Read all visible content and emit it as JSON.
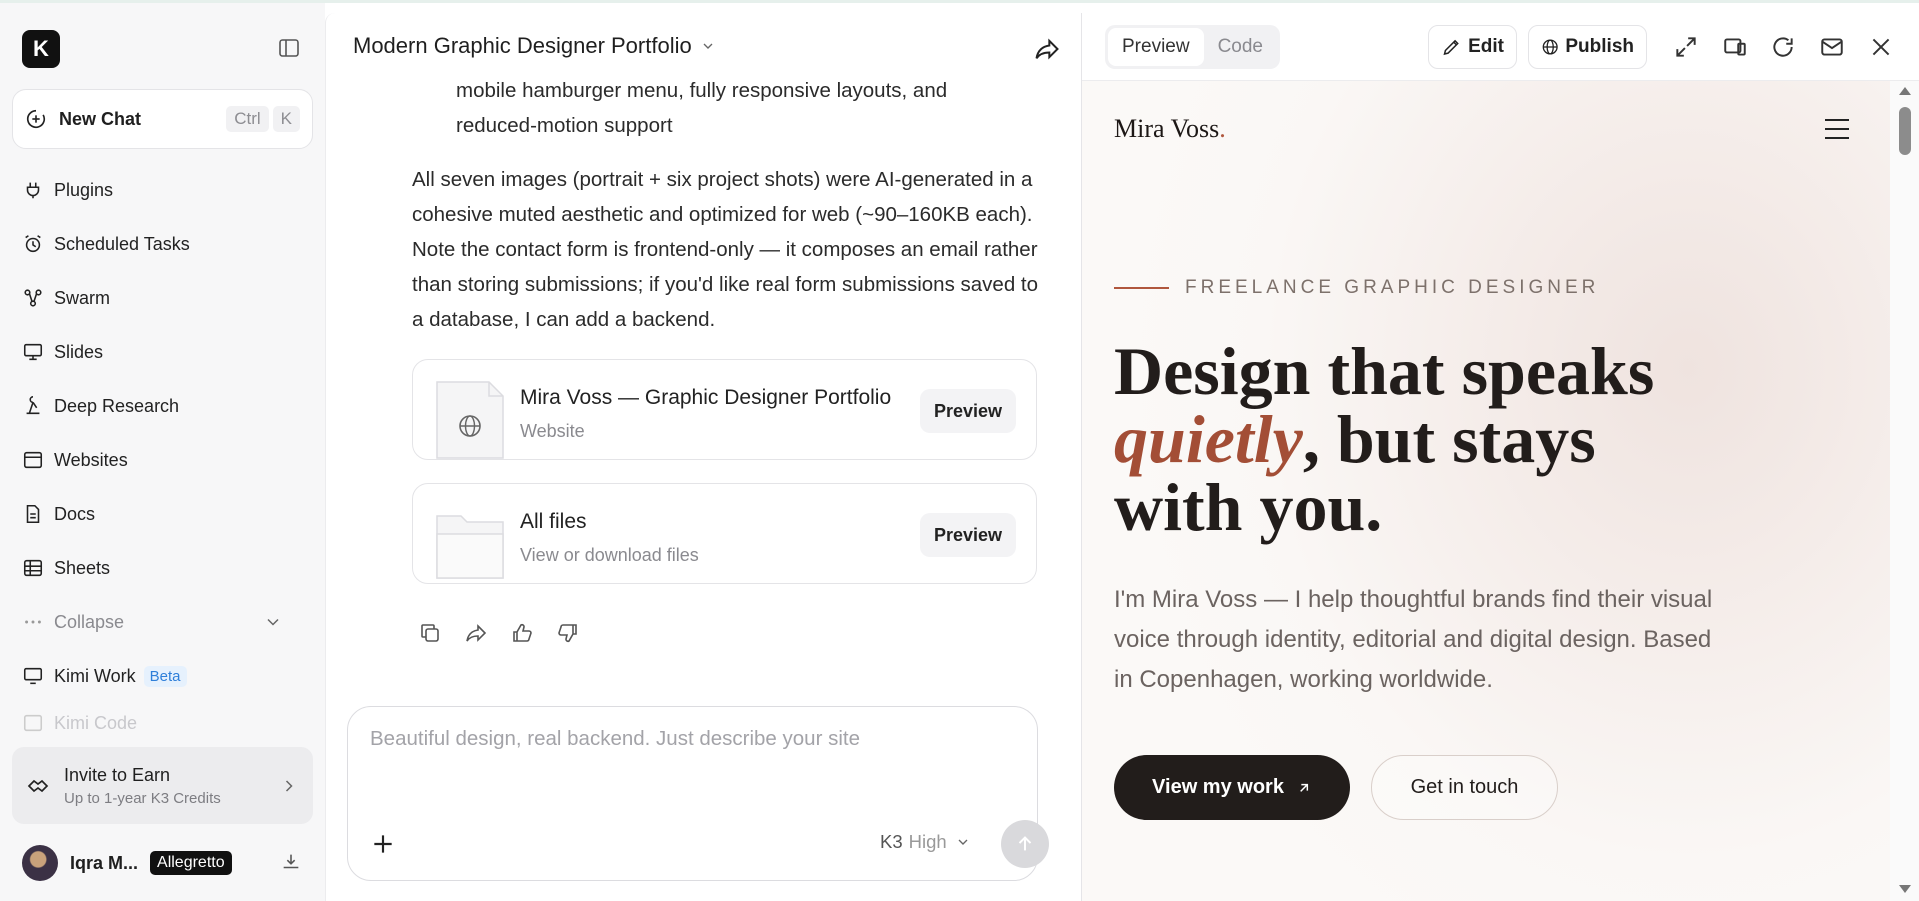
{
  "app": {
    "logo_letter": "K"
  },
  "sidebar": {
    "new_chat": {
      "label": "New Chat",
      "shortcut_mod": "Ctrl",
      "shortcut_key": "K"
    },
    "items": [
      {
        "label": "Plugins",
        "icon": "plug-icon"
      },
      {
        "label": "Scheduled Tasks",
        "icon": "alarm-clock-icon"
      },
      {
        "label": "Swarm",
        "icon": "swarm-icon"
      },
      {
        "label": "Slides",
        "icon": "presentation-icon"
      },
      {
        "label": "Deep Research",
        "icon": "research-icon"
      },
      {
        "label": "Websites",
        "icon": "browser-window-icon"
      },
      {
        "label": "Docs",
        "icon": "document-icon"
      },
      {
        "label": "Sheets",
        "icon": "table-icon"
      }
    ],
    "collapse_label": "Collapse",
    "kimi_work": {
      "label": "Kimi Work",
      "badge": "Beta"
    },
    "kimi_code": {
      "label": "Kimi Code"
    },
    "invite": {
      "title": "Invite to Earn",
      "subtitle": "Up to 1-year K3 Credits"
    },
    "user": {
      "name": "Iqra M...",
      "plan": "Allegretto"
    }
  },
  "chat": {
    "title": "Modern Graphic Designer Portfolio",
    "message_top": "mobile hamburger menu, fully responsive layouts, and reduced-motion support",
    "message_para": "All seven images (portrait + six project shots) were AI-generated in a cohesive muted aesthetic and optimized for web (~90–160KB each). Note the contact form is frontend-only — it composes an email rather than storing submissions; if you'd like real form submissions saved to a database, I can add a backend.",
    "cards": [
      {
        "title": "Mira Voss — Graphic Designer Portfolio",
        "subtitle": "Website",
        "button": "Preview"
      },
      {
        "title": "All files",
        "subtitle": "View or download files",
        "button": "Preview"
      }
    ],
    "composer": {
      "placeholder": "Beautiful design, real backend. Just describe your site",
      "model": "K3",
      "level": "High"
    }
  },
  "panel": {
    "tabs": {
      "preview": "Preview",
      "code": "Code"
    },
    "edit_label": "Edit",
    "publish_label": "Publish"
  },
  "site": {
    "brand": "Mira Voss",
    "brand_dot": ".",
    "eyebrow": "FREELANCE GRAPHIC DESIGNER",
    "hero_line1": "Design that speaks",
    "hero_emph": "quietly",
    "hero_line2_rest": ", but stays",
    "hero_line3": "with you.",
    "lede": "I'm Mira Voss — I help thoughtful brands find their visual voice through identity, editorial and digital design. Based in Copenhagen, working worldwide.",
    "cta_primary": "View my work",
    "cta_secondary": "Get in touch",
    "accent_color": "#a34e36"
  }
}
